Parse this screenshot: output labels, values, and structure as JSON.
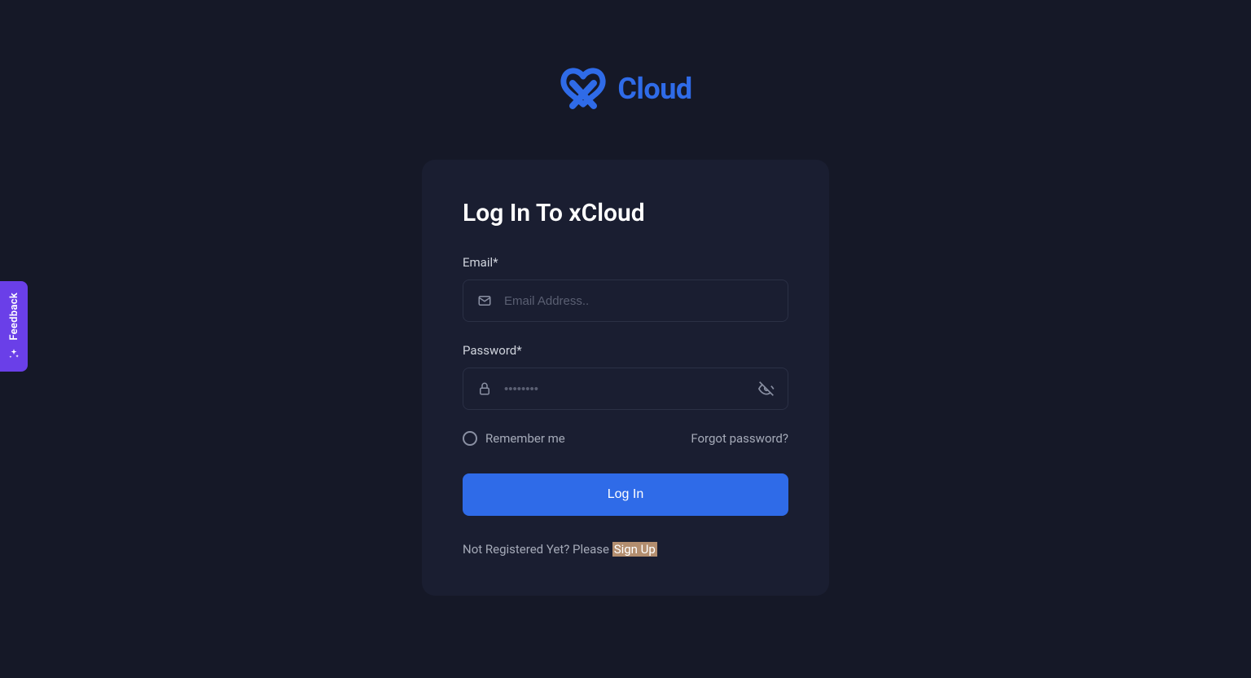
{
  "brand": {
    "name": "Cloud",
    "accent": "#2F6BE8"
  },
  "feedback": {
    "label": "Feedback"
  },
  "login": {
    "title": "Log In To xCloud",
    "email_label": "Email*",
    "email_placeholder": "Email Address..",
    "email_value": "",
    "password_label": "Password*",
    "password_placeholder": "••••••••",
    "password_value": "",
    "remember_label": "Remember me",
    "remember_checked": false,
    "forgot_label": "Forgot password?",
    "submit_label": "Log In",
    "footer_prompt": "Not Registered Yet? Please ",
    "signup_label": "Sign Up"
  }
}
